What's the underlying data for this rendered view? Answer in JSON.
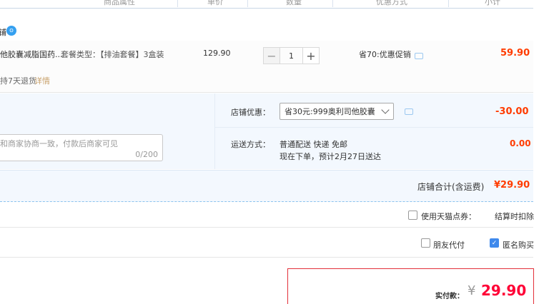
{
  "header": {
    "columns": [
      "商品属性",
      "单价",
      "数量",
      "优惠方式",
      "小计"
    ]
  },
  "shop": {
    "name_fragment": "铺",
    "badge_icon": "wangwang-icon"
  },
  "item": {
    "title": "他胶囊减脂国药...",
    "package": "套餐类型：【排油套餐】3盒装",
    "price": "129.90",
    "quantity": "1",
    "promo": "省70:优惠促销",
    "subtotal": "59.90",
    "return_policy": "持7天退货",
    "return_link": "详情"
  },
  "options": {
    "message_placeholder": "和商家协商一致，付款后商家可见",
    "message_count": "0/200",
    "discount_label": "店铺优惠：",
    "discount_selected": "省30元:999奥利司他胶囊",
    "discount_amount": "-30.00",
    "shipping_label": "运送方式：",
    "shipping_method": "普通配送 快递 免邮",
    "shipping_eta": "现在下单，预计2月27日送达",
    "shipping_amount": "0.00"
  },
  "shop_total": {
    "label": "店铺合计(含运费)",
    "amount": "¥29.90"
  },
  "points": {
    "label": "使用天猫点券：",
    "note": "结算时扣除"
  },
  "extras": {
    "friend_pay": "朋友代付",
    "anonymous": "匿名购买"
  },
  "payment": {
    "label": "实付款：",
    "currency": "¥",
    "amount": "29.90"
  },
  "colors": {
    "accent_blue": "#3f89ec",
    "price_red": "#ff3c00",
    "panel_bg": "#f3f8fe"
  }
}
